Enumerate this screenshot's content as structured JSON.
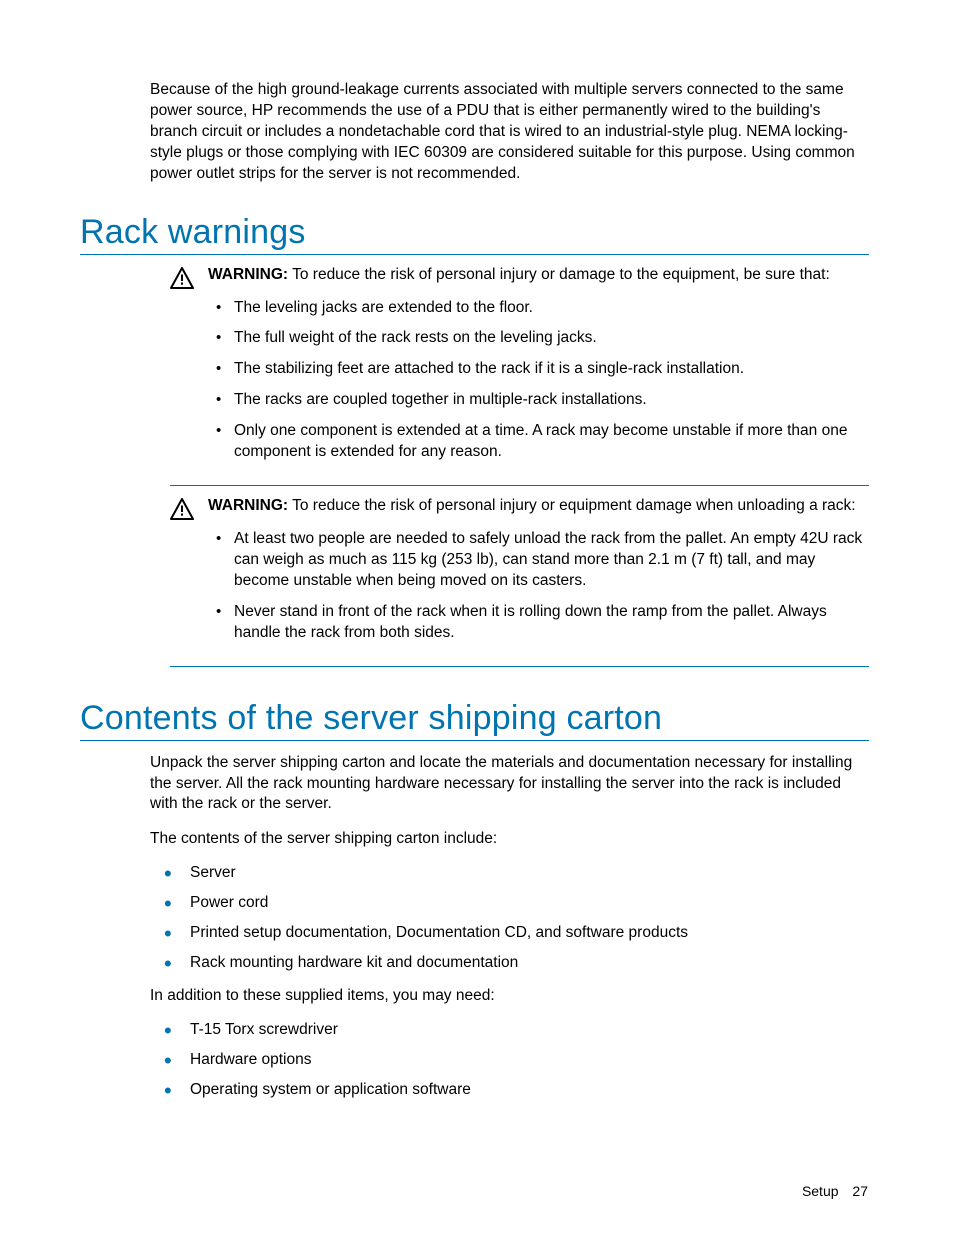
{
  "intro": "Because of the high ground-leakage currents associated with multiple servers connected to the same power source, HP recommends the use of a PDU that is either permanently wired to the building's branch circuit or includes a nondetachable cord that is wired to an industrial-style plug. NEMA locking-style plugs or those complying with IEC 60309 are considered suitable for this purpose. Using common power outlet strips for the server is not recommended.",
  "rack": {
    "title": "Rack warnings",
    "warn1": {
      "label": "WARNING:",
      "lead": "  To reduce the risk of personal injury or damage to the equipment, be sure that:",
      "bullets": [
        "The leveling jacks are extended to the floor.",
        "The full weight of the rack rests on the leveling jacks.",
        "The stabilizing feet are attached to the rack if it is a single-rack installation.",
        "The racks are coupled together in multiple-rack installations.",
        "Only one component is extended at a time. A rack may become unstable if more than one component is extended for any reason."
      ]
    },
    "warn2": {
      "label": "WARNING:",
      "lead": "  To reduce the risk of personal injury or equipment damage when unloading a rack:",
      "bullets": [
        "At least two people are needed to safely unload the rack from the pallet. An empty 42U rack can weigh as much as 115 kg (253 lb), can stand more than 2.1 m (7 ft) tall, and may become unstable when being moved on its casters.",
        "Never stand in front of the rack when it is rolling down the ramp from the pallet. Always handle the rack from both sides."
      ]
    }
  },
  "contents": {
    "title": "Contents of the server shipping carton",
    "para1": "Unpack the server shipping carton and locate the materials and documentation necessary for installing the server. All the rack mounting hardware necessary for installing the server into the rack is included with the rack or the server.",
    "para2": "The contents of the server shipping carton include:",
    "list1": [
      "Server",
      "Power cord",
      "Printed setup documentation, Documentation CD, and software products",
      "Rack mounting hardware kit and documentation"
    ],
    "para3": "In addition to these supplied items, you may need:",
    "list2": [
      "T-15 Torx screwdriver",
      "Hardware options",
      "Operating system or application software"
    ]
  },
  "footer": {
    "section": "Setup",
    "page": "27"
  }
}
